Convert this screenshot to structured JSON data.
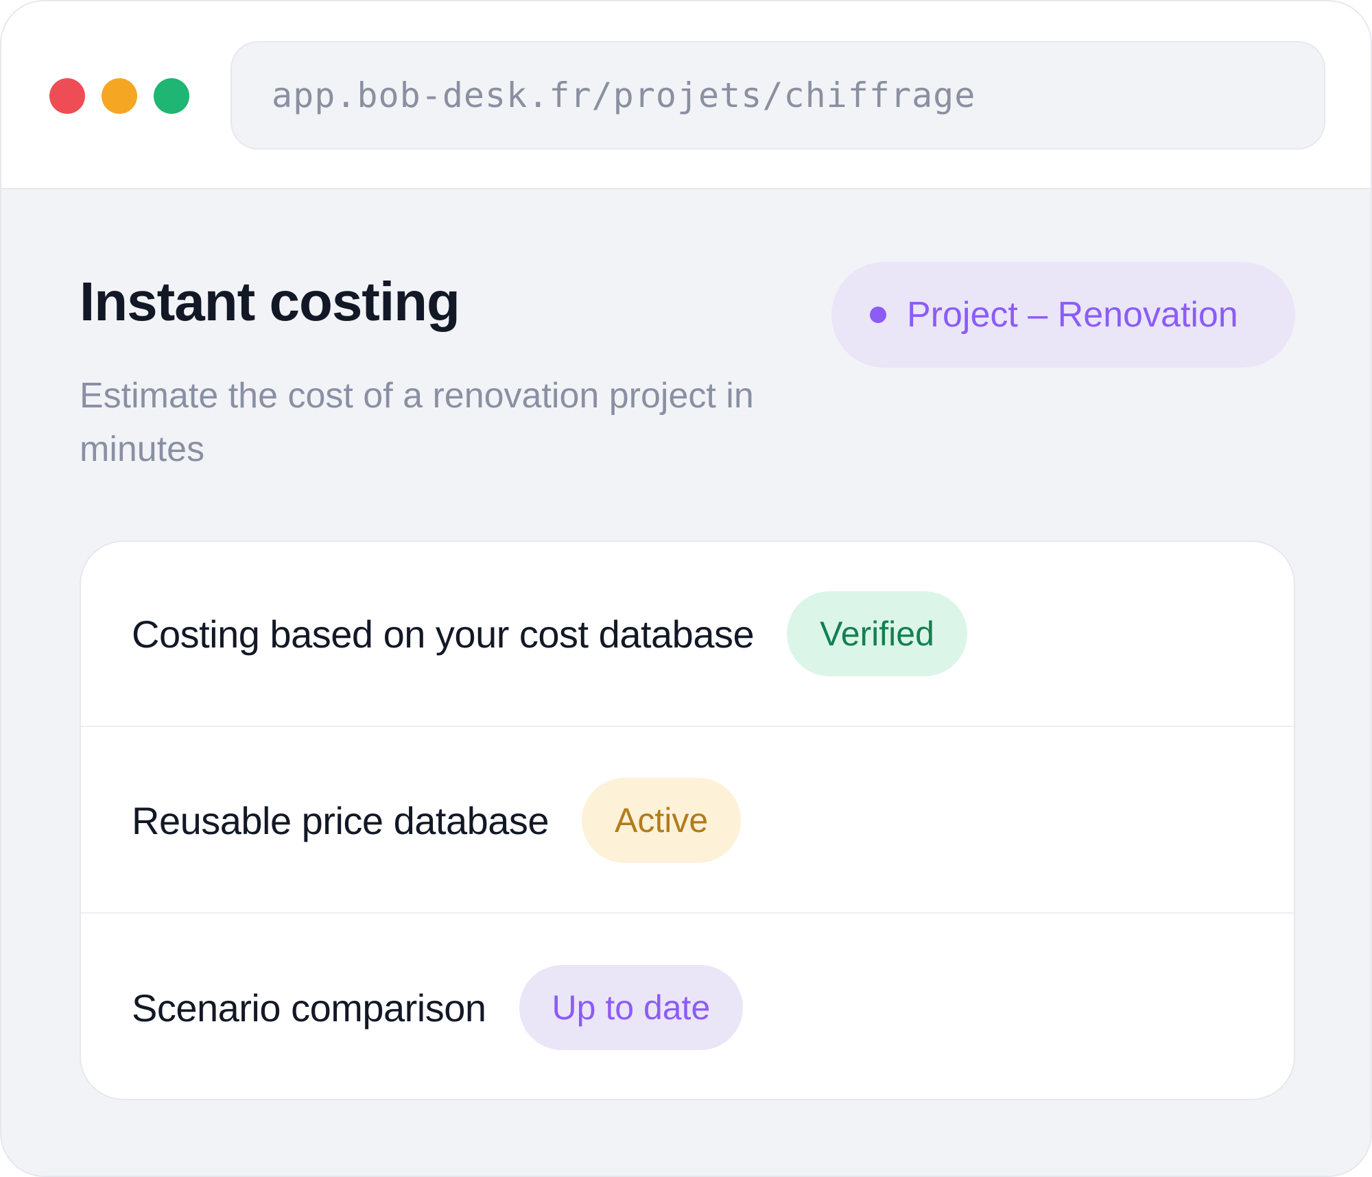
{
  "browser": {
    "url": "app.bob-desk.fr/projets/chiffrage",
    "controls": {
      "close_color": "#ef4d55",
      "minimize_color": "#f5a623",
      "maximize_color": "#1fb573"
    }
  },
  "header": {
    "title": "Instant costing",
    "subtitle": "Estimate the cost of a renovation project in minutes",
    "project_badge": "Project – Renovation"
  },
  "features": [
    {
      "label": "Costing based on your cost database",
      "status": "Verified",
      "status_bg": "#dcf5e9",
      "status_fg": "#13804f"
    },
    {
      "label": "Reusable price database",
      "status": "Active",
      "status_bg": "#fdf1d8",
      "status_fg": "#b27c1c"
    },
    {
      "label": "Scenario comparison",
      "status": "Up to date",
      "status_bg": "#ebe5f8",
      "status_fg": "#8b5cf6"
    }
  ]
}
